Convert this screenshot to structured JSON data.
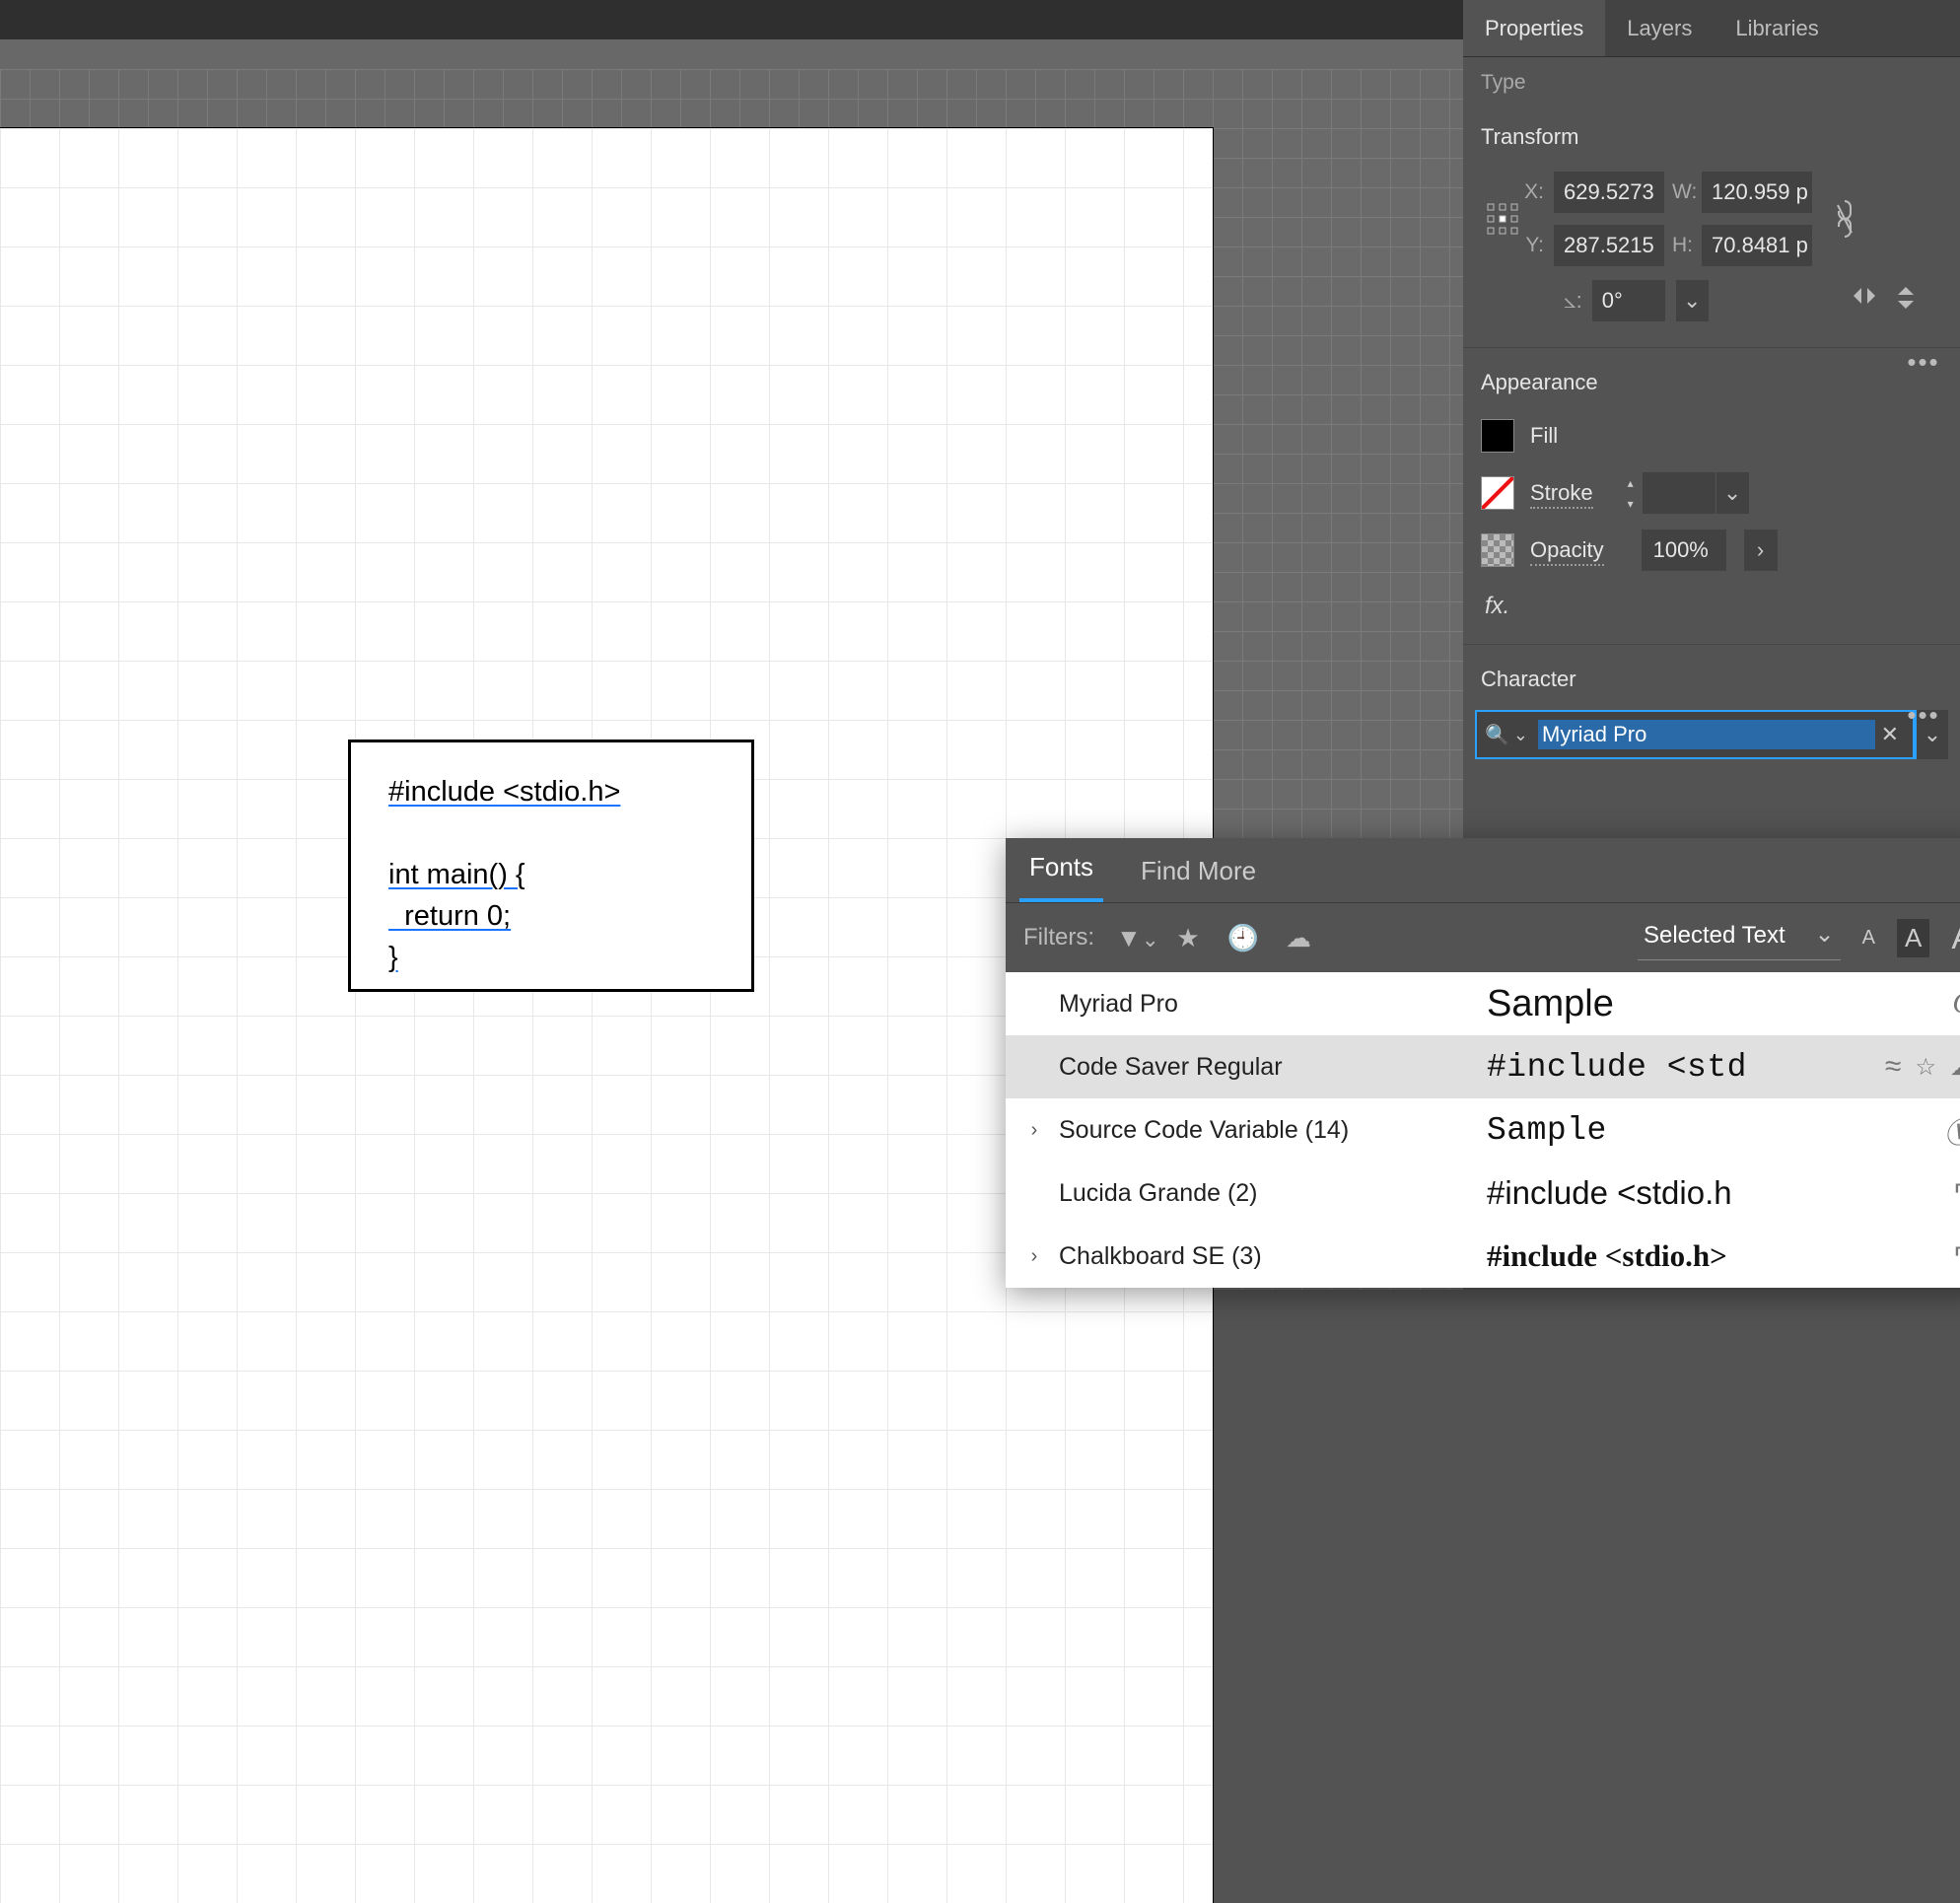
{
  "tabs": {
    "properties": "Properties",
    "layers": "Layers",
    "libraries": "Libraries"
  },
  "selection_type": "Type",
  "transform": {
    "title": "Transform",
    "x_label": "X:",
    "x": "629.5273",
    "y_label": "Y:",
    "y": "287.5215",
    "w_label": "W:",
    "w": "120.959 p",
    "h_label": "H:",
    "h": "70.8481 p",
    "angle_label": "⦣:",
    "angle": "0°"
  },
  "appearance": {
    "title": "Appearance",
    "fill": "Fill",
    "stroke": "Stroke",
    "opacity": "Opacity",
    "opacity_value": "100%",
    "fx": "fx."
  },
  "character": {
    "title": "Character",
    "font_family": "Myriad Pro"
  },
  "text_frame": {
    "line1": "#include <stdio.h>",
    "line2": "",
    "line3": "int main() {",
    "line4": "  return 0;",
    "line5": "}"
  },
  "font_popup": {
    "tabs": {
      "fonts": "Fonts",
      "find_more": "Find More"
    },
    "filters_label": "Filters:",
    "selected_text": "Selected Text",
    "rows": [
      {
        "expandable": false,
        "name": "Myriad Pro",
        "sample": "Sample",
        "sample_class": "smp-myriad",
        "badge": "O"
      },
      {
        "expandable": false,
        "name": "Code Saver Regular",
        "sample": "#include <std",
        "sample_class": "smp-mono",
        "badges": [
          "≈",
          "☆",
          "☁"
        ],
        "selected": true
      },
      {
        "expandable": true,
        "name": "Source Code Variable (14)",
        "sample": "Sample",
        "sample_class": "smp-mono",
        "badge": "Ⓥ"
      },
      {
        "expandable": false,
        "name": "Lucida Grande (2)",
        "sample": "#include <stdio.h",
        "sample_class": "smp-lucida",
        "badge": "Ͳ"
      },
      {
        "expandable": true,
        "name": "Chalkboard SE (3)",
        "sample": "#include <stdio.h>",
        "sample_class": "smp-chalk",
        "badge": "Ͳ"
      }
    ]
  }
}
